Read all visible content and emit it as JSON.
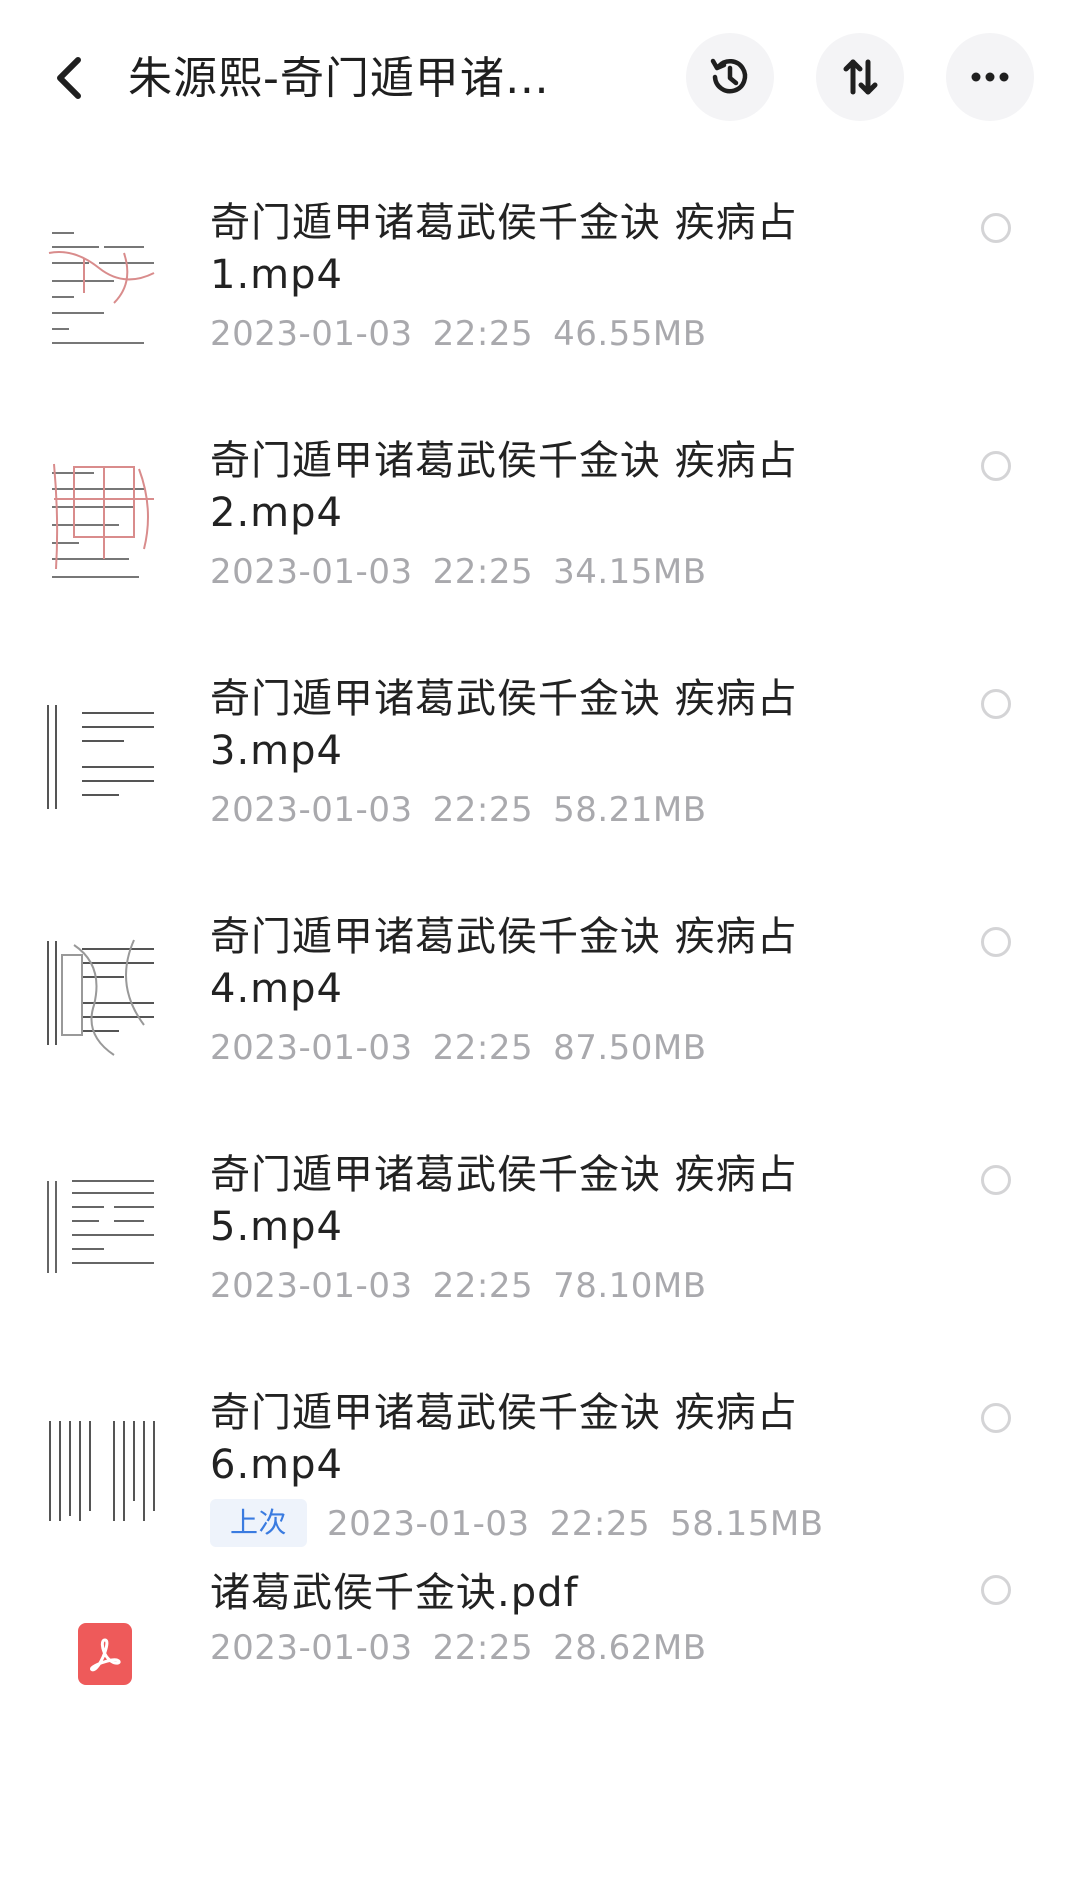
{
  "header": {
    "title": "朱源熙-奇门遁甲诸…",
    "back_icon": "chevron-left-icon",
    "history_icon": "history-icon",
    "sort_icon": "sort-icon",
    "more_icon": "more-dots-icon"
  },
  "files": [
    {
      "name": "奇门遁甲诸葛武侯千金诀 疾病占1.mp4",
      "date": "2023-01-03",
      "time": "22:25",
      "size": "46.55MB",
      "badge": ""
    },
    {
      "name": "奇门遁甲诸葛武侯千金诀 疾病占2.mp4",
      "date": "2023-01-03",
      "time": "22:25",
      "size": "34.15MB",
      "badge": ""
    },
    {
      "name": "奇门遁甲诸葛武侯千金诀 疾病占3.mp4",
      "date": "2023-01-03",
      "time": "22:25",
      "size": "58.21MB",
      "badge": ""
    },
    {
      "name": "奇门遁甲诸葛武侯千金诀 疾病占4.mp4",
      "date": "2023-01-03",
      "time": "22:25",
      "size": "87.50MB",
      "badge": ""
    },
    {
      "name": "奇门遁甲诸葛武侯千金诀 疾病占5.mp4",
      "date": "2023-01-03",
      "time": "22:25",
      "size": "78.10MB",
      "badge": ""
    },
    {
      "name": "奇门遁甲诸葛武侯千金诀 疾病占6.mp4",
      "date": "2023-01-03",
      "time": "22:25",
      "size": "58.15MB",
      "badge": "上次"
    },
    {
      "name": "诸葛武侯千金诀.pdf",
      "date": "2023-01-03",
      "time": "22:25",
      "size": "28.62MB",
      "badge": ""
    }
  ],
  "colors": {
    "pdf": "#ee5a5a",
    "badge_text": "#3a7be0",
    "meta": "#a9a9ad"
  }
}
